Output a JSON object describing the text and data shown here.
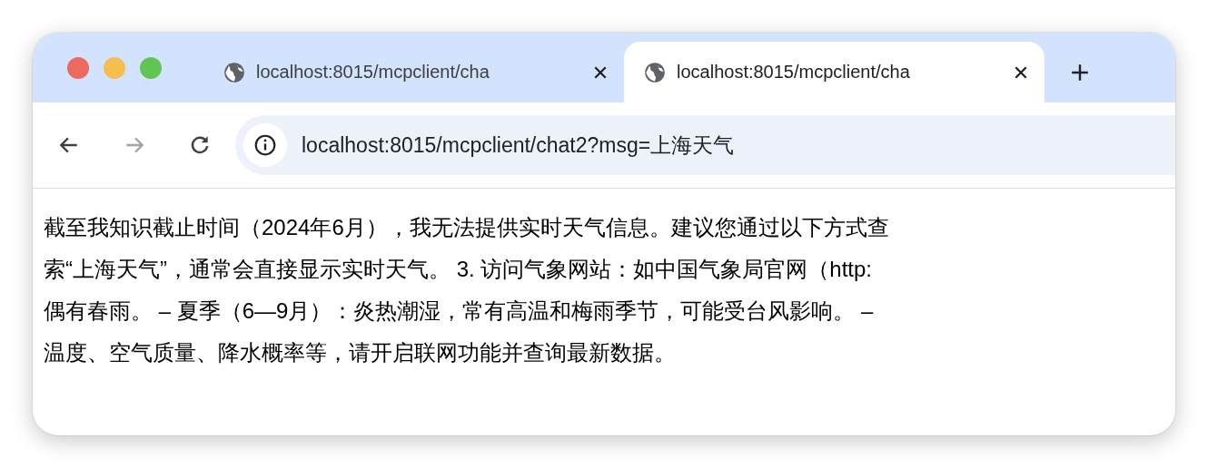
{
  "tabs": [
    {
      "title": "localhost:8015/mcpclient/cha",
      "selected": false
    },
    {
      "title": "localhost:8015/mcpclient/cha",
      "selected": true
    }
  ],
  "toolbar": {
    "back_disabled": false,
    "forward_disabled": true,
    "address": "localhost:8015/mcpclient/chat2?msg=上海天气"
  },
  "content": {
    "lines": [
      "截至我知识截止时间（2024年6月），我无法提供实时天气信息。建议您通过以下方式查",
      "索“上海天气”，通常会直接显示实时天气。 3. 访问气象网站：如中国气象局官网（http:",
      "偶有春雨。 – 夏季（6—9月）：炎热潮湿，常有高温和梅雨季节，可能受台风影响。 –",
      "温度、空气质量、降水概率等，请开启联网功能并查询最新数据。"
    ]
  }
}
